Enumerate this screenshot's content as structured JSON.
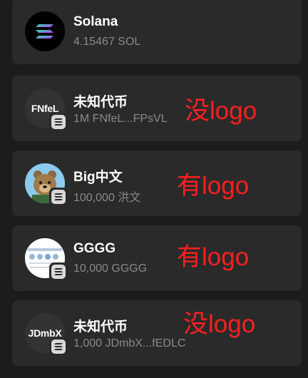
{
  "tokens": [
    {
      "name": "Solana",
      "amount": "4.15467 SOL",
      "icon": "solana-logo-icon"
    },
    {
      "name": "未知代币",
      "amount": "1M FNfeL...FPsVL",
      "avatar_text": "FNfeL",
      "annotation": "没logo",
      "icon": "placeholder-text-icon"
    },
    {
      "name": "Big中文",
      "amount": "100,000 洪文",
      "annotation": "有logo",
      "icon": "bear-logo-icon"
    },
    {
      "name": "GGGG",
      "amount": "10,000 GGGG",
      "annotation": "有logo",
      "icon": "screenshot-logo-icon"
    },
    {
      "name": "未知代币",
      "amount": "1,000 JDmbX...fEDLC",
      "avatar_text": "JDmbX",
      "annotation": "没logo",
      "icon": "placeholder-text-icon"
    }
  ],
  "colors": {
    "background": "#1c1c1c",
    "card": "#2a2a2a",
    "annotation": "#ff1f1f",
    "secondary_text": "#8a8a8a"
  }
}
